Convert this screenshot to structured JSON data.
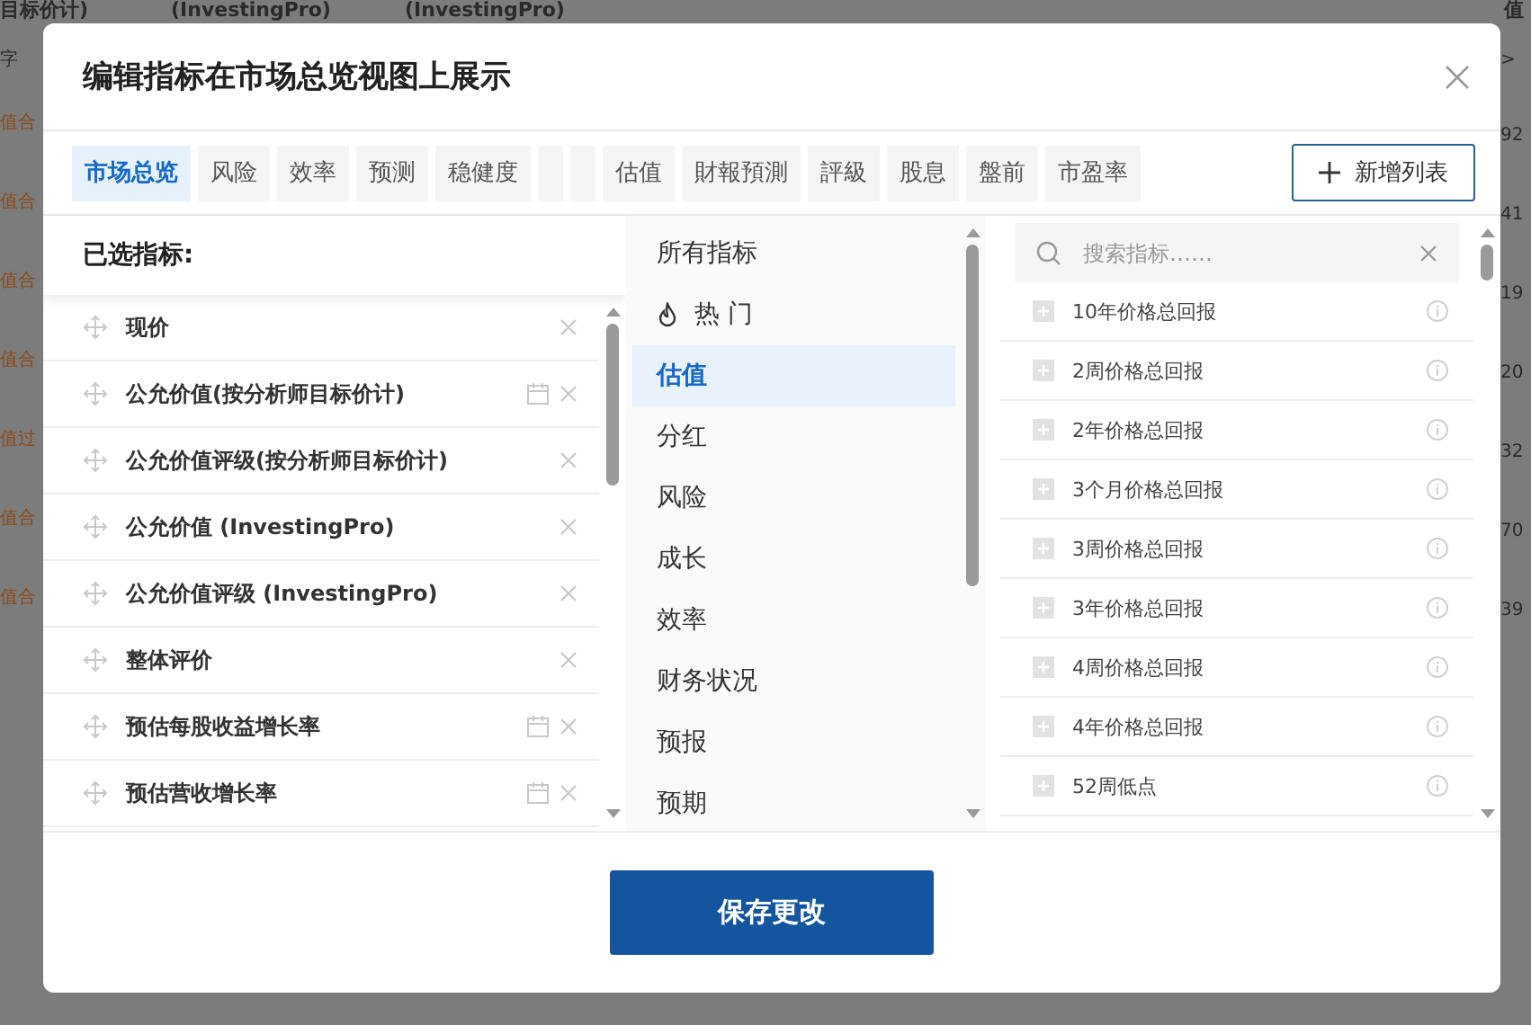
{
  "background_table": {
    "header_cells": [
      "目标价计)",
      "(InvestingPro)",
      "(InvestingPro)",
      "值"
    ],
    "left_header": "字",
    "right_header": ">",
    "left_labels": [
      "值合",
      "值合",
      "值合",
      "值合",
      "值过",
      "值合",
      "值合"
    ],
    "right_values": [
      "92",
      "41",
      "19",
      "20",
      "32",
      "70",
      "39"
    ]
  },
  "dialog": {
    "title": "编辑指标在市场总览视图上展示",
    "tabs": [
      {
        "label": "市场总览",
        "kind": "text",
        "selected": true
      },
      {
        "label": "风险",
        "kind": "text",
        "selected": false
      },
      {
        "label": "效率",
        "kind": "text",
        "selected": false
      },
      {
        "label": "预测",
        "kind": "text",
        "selected": false
      },
      {
        "label": "稳健度",
        "kind": "text",
        "selected": false
      },
      {
        "kind": "blank",
        "selected": false
      },
      {
        "kind": "blank",
        "selected": false
      },
      {
        "label": "估值",
        "kind": "text",
        "selected": false
      },
      {
        "label": "財報預測",
        "kind": "text",
        "selected": false
      },
      {
        "label": "評級",
        "kind": "text",
        "selected": false
      },
      {
        "label": "股息",
        "kind": "text",
        "selected": false
      },
      {
        "label": "盤前",
        "kind": "text",
        "selected": false
      },
      {
        "label": "市盈率",
        "kind": "text",
        "selected": false
      }
    ],
    "add_list_button": "新增列表",
    "selected_panel": {
      "title": "已选指标:",
      "items": [
        {
          "name": "现价",
          "dated": false
        },
        {
          "name": "公允价值(按分析师目标价计)",
          "dated": true
        },
        {
          "name": "公允价值评级(按分析师目标价计)",
          "dated": false
        },
        {
          "name": "公允价值 (InvestingPro)",
          "dated": false
        },
        {
          "name": "公允价值评级 (InvestingPro)",
          "dated": false
        },
        {
          "name": "整体评价",
          "dated": false
        },
        {
          "name": "预估每股收益增长率",
          "dated": true
        },
        {
          "name": "预估营收增长率",
          "dated": true
        }
      ]
    },
    "categories": [
      {
        "label": "所有指标",
        "kind": "plain",
        "selected": false
      },
      {
        "label": "热 门",
        "kind": "hot",
        "selected": false
      },
      {
        "label": "估值",
        "kind": "plain",
        "selected": true
      },
      {
        "label": "分红",
        "kind": "plain",
        "selected": false
      },
      {
        "label": "风险",
        "kind": "plain",
        "selected": false
      },
      {
        "label": "成长",
        "kind": "plain",
        "selected": false
      },
      {
        "label": "效率",
        "kind": "plain",
        "selected": false
      },
      {
        "label": "财务状况",
        "kind": "plain",
        "selected": false
      },
      {
        "label": "预报",
        "kind": "plain",
        "selected": false
      },
      {
        "label": "预期",
        "kind": "plain",
        "selected": false
      }
    ],
    "search": {
      "placeholder": "搜索指标……"
    },
    "metrics": [
      "10年价格总回报",
      "2周价格总回报",
      "2年价格总回报",
      "3个月价格总回报",
      "3周价格总回报",
      "3年价格总回报",
      "4周价格总回报",
      "4年价格总回报",
      "52周低点"
    ],
    "save_button": "保存更改"
  }
}
